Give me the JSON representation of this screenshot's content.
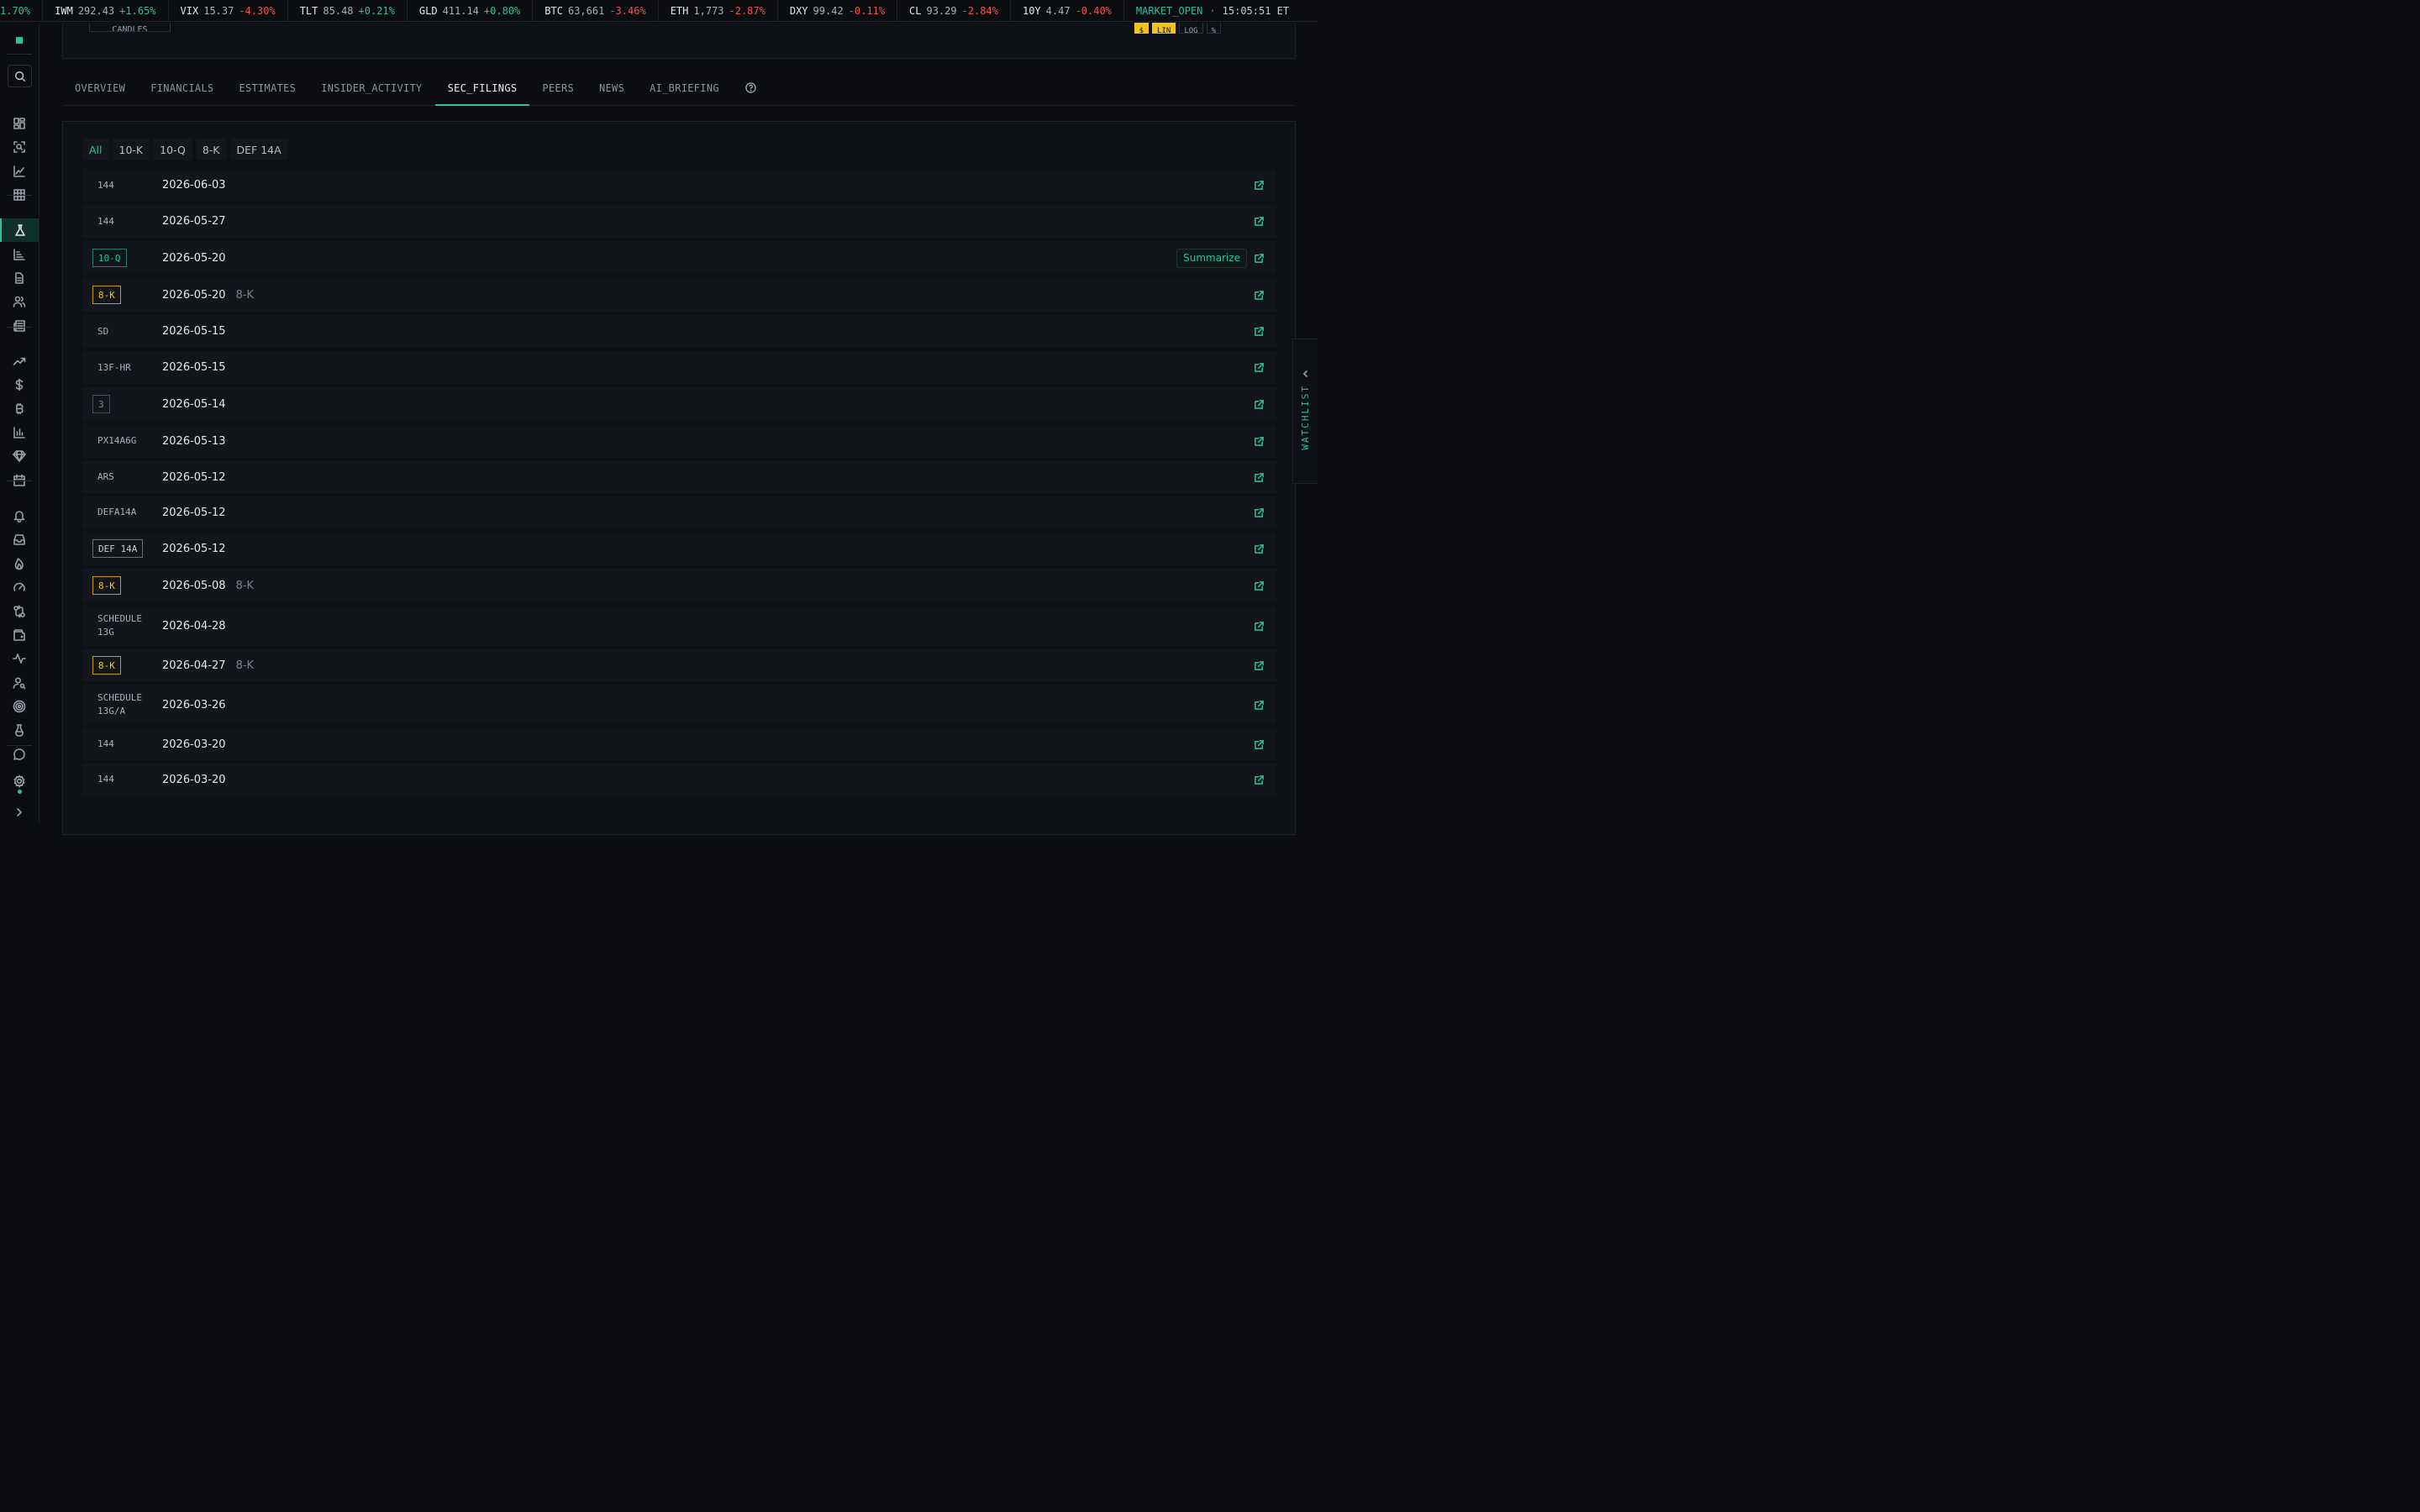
{
  "ticker": [
    {
      "sym": "",
      "price": "",
      "chg": "1.70%",
      "dir": "up"
    },
    {
      "sym": "IWM",
      "price": "292.43",
      "chg": "+1.65%",
      "dir": "up"
    },
    {
      "sym": "VIX",
      "price": "15.37",
      "chg": "-4.30%",
      "dir": "down"
    },
    {
      "sym": "TLT",
      "price": "85.48",
      "chg": "+0.21%",
      "dir": "up"
    },
    {
      "sym": "GLD",
      "price": "411.14",
      "chg": "+0.80%",
      "dir": "up"
    },
    {
      "sym": "BTC",
      "price": "63,661",
      "chg": "-3.46%",
      "dir": "down"
    },
    {
      "sym": "ETH",
      "price": "1,773",
      "chg": "-2.87%",
      "dir": "down"
    },
    {
      "sym": "DXY",
      "price": "99.42",
      "chg": "-0.11%",
      "dir": "down"
    },
    {
      "sym": "CL",
      "price": "93.29",
      "chg": "-2.84%",
      "dir": "down"
    },
    {
      "sym": "10Y",
      "price": "4.47",
      "chg": "-0.40%",
      "dir": "down"
    }
  ],
  "status": {
    "market": "MARKET_OPEN",
    "separator": "·",
    "time": "15:05:51 ET"
  },
  "chart_toolbar": {
    "chart_type": "CANDLES",
    "scale_buttons": [
      {
        "label": "$",
        "active": true
      },
      {
        "label": "LIN",
        "active": true
      },
      {
        "label": "LOG",
        "active": false
      },
      {
        "label": "%",
        "active": false
      }
    ]
  },
  "tabs": [
    {
      "label": "OVERVIEW",
      "active": false
    },
    {
      "label": "FINANCIALS",
      "active": false
    },
    {
      "label": "ESTIMATES",
      "active": false
    },
    {
      "label": "INSIDER_ACTIVITY",
      "active": false
    },
    {
      "label": "SEC_FILINGS",
      "active": true
    },
    {
      "label": "PEERS",
      "active": false
    },
    {
      "label": "NEWS",
      "active": false
    },
    {
      "label": "AI_BRIEFING",
      "active": false
    }
  ],
  "filters": [
    {
      "label": "All",
      "active": true
    },
    {
      "label": "10-K",
      "active": false
    },
    {
      "label": "10-Q",
      "active": false
    },
    {
      "label": "8-K",
      "active": false
    },
    {
      "label": "DEF 14A",
      "active": false
    }
  ],
  "summarize_label": "Summarize",
  "filings": [
    {
      "form": "144",
      "style": "plain",
      "date": "2026-06-03",
      "desc": ""
    },
    {
      "form": "144",
      "style": "plain",
      "date": "2026-05-27",
      "desc": ""
    },
    {
      "form": "10-Q",
      "style": "teal",
      "date": "2026-05-20",
      "desc": "",
      "summarize": true
    },
    {
      "form": "8-K",
      "style": "amber",
      "date": "2026-05-20",
      "desc": "8-K"
    },
    {
      "form": "SD",
      "style": "plain",
      "date": "2026-05-15",
      "desc": ""
    },
    {
      "form": "13F-HR",
      "style": "plain",
      "date": "2026-05-15",
      "desc": ""
    },
    {
      "form": "3",
      "style": "grey",
      "date": "2026-05-14",
      "desc": ""
    },
    {
      "form": "PX14A6G",
      "style": "plain",
      "date": "2026-05-13",
      "desc": ""
    },
    {
      "form": "ARS",
      "style": "plain",
      "date": "2026-05-12",
      "desc": ""
    },
    {
      "form": "DEFA14A",
      "style": "plain",
      "date": "2026-05-12",
      "desc": ""
    },
    {
      "form": "DEF 14A",
      "style": "box",
      "date": "2026-05-12",
      "desc": ""
    },
    {
      "form": "8-K",
      "style": "amber",
      "date": "2026-05-08",
      "desc": "8-K"
    },
    {
      "form": "SCHEDULE 13G",
      "style": "plain",
      "date": "2026-04-28",
      "desc": ""
    },
    {
      "form": "8-K",
      "style": "amber",
      "date": "2026-04-27",
      "desc": "8-K"
    },
    {
      "form": "SCHEDULE 13G/A",
      "style": "plain",
      "date": "2026-03-26",
      "desc": ""
    },
    {
      "form": "144",
      "style": "plain",
      "date": "2026-03-20",
      "desc": ""
    },
    {
      "form": "144",
      "style": "plain",
      "date": "2026-03-20",
      "desc": ""
    }
  ],
  "rail_icons": [
    "dashboard-icon",
    "screener-icon",
    "chart-icon",
    "grid-icon",
    "flask-icon",
    "bar-chart-icon",
    "document-icon",
    "users-icon",
    "news-icon",
    "trending-up-icon",
    "dollar-icon",
    "bitcoin-icon",
    "bar-graph-icon",
    "diamond-icon",
    "calendar-icon",
    "bell-icon",
    "inbox-icon",
    "flame-icon",
    "gauge-icon",
    "swap-icon",
    "wallet-icon",
    "activity-icon",
    "user-search-icon",
    "target-icon",
    "beaker-icon",
    "chat-icon",
    "settings-icon"
  ],
  "watchlist_label": "WATCHLIST"
}
